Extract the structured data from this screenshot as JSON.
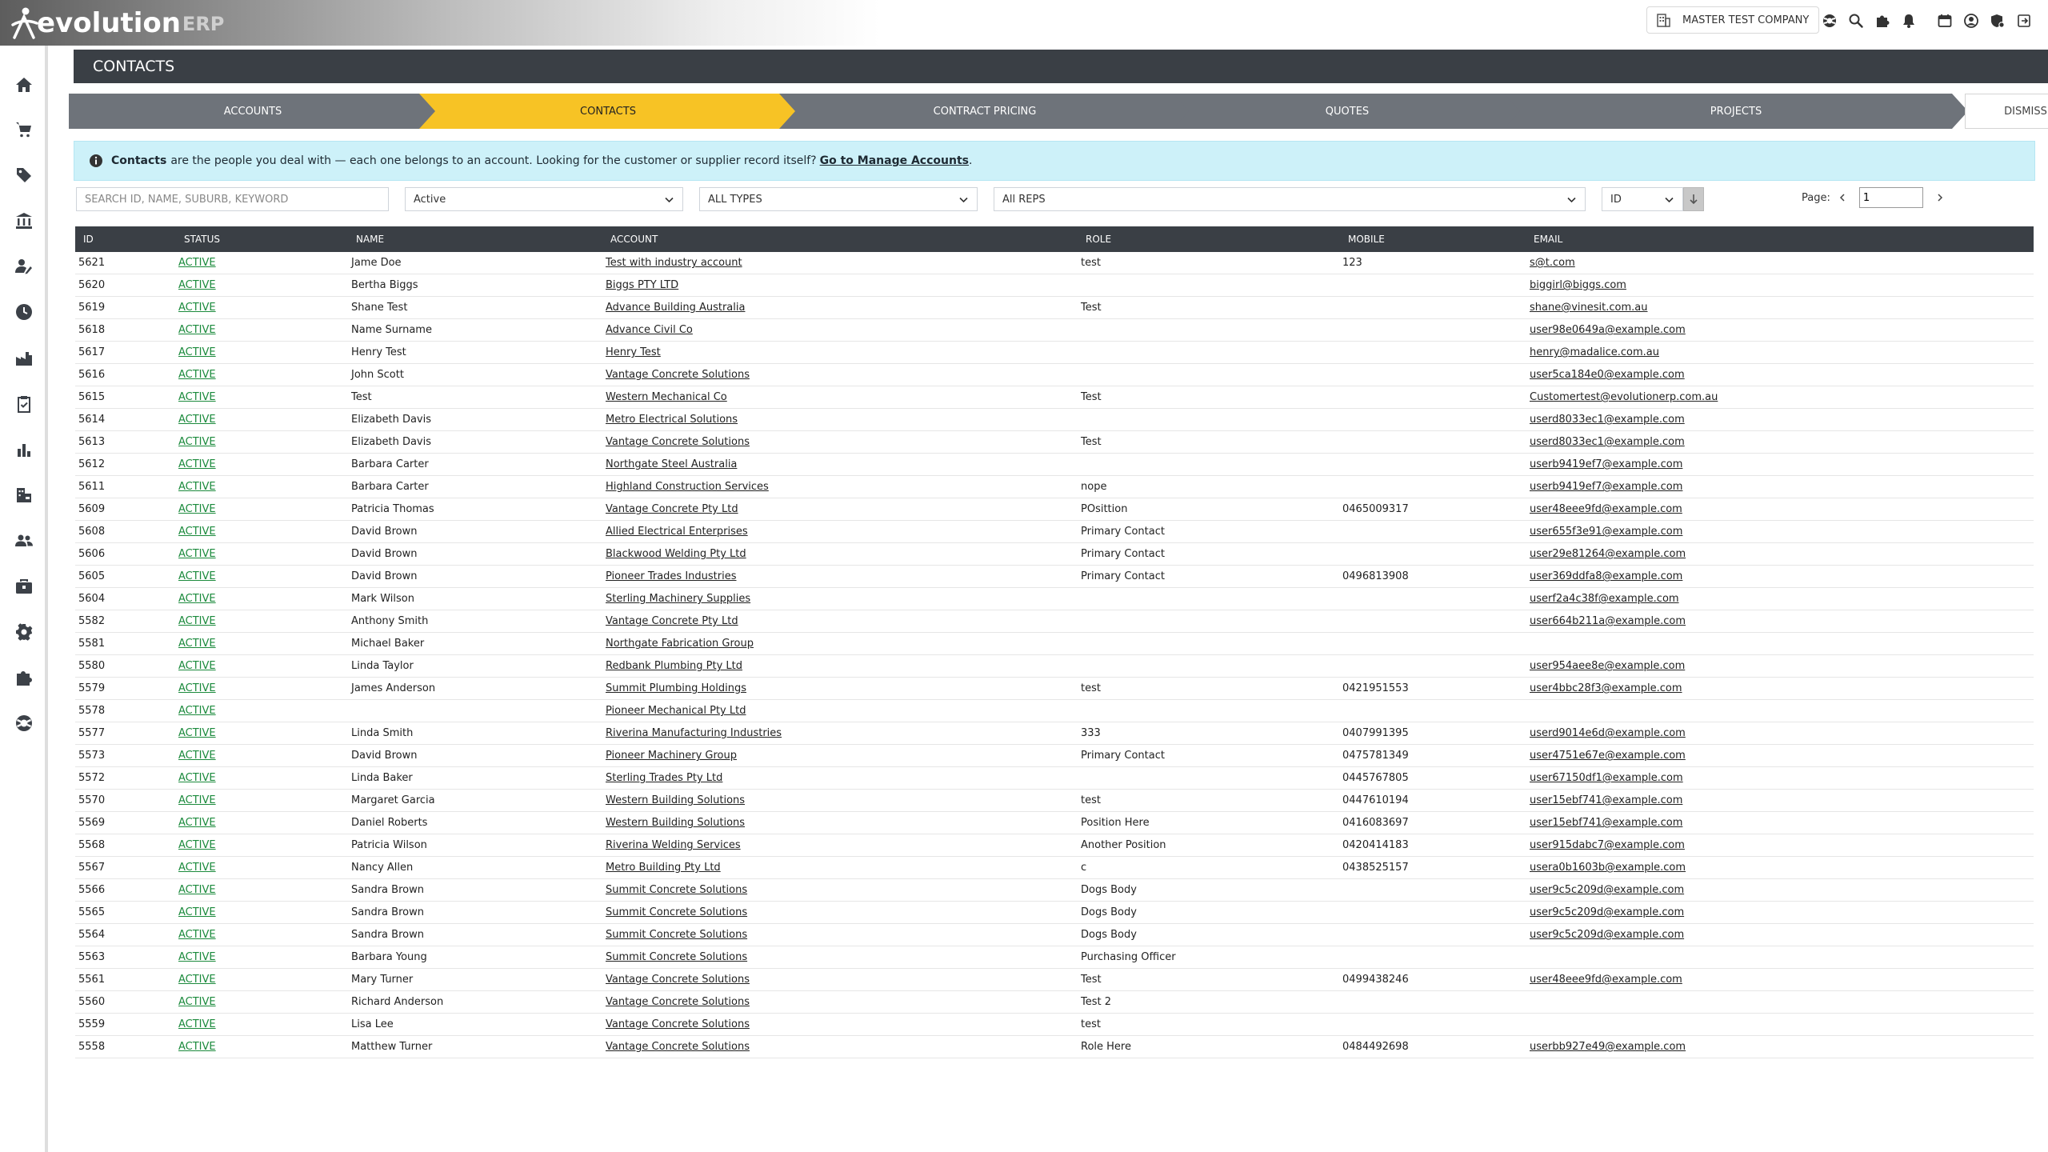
{
  "header": {
    "logo_text": "evolution",
    "logo_suffix": "ERP",
    "company": "MASTER TEST COMPANY"
  },
  "page": {
    "title": "CONTACTS"
  },
  "steps": [
    {
      "label": "ACCOUNTS",
      "active": false
    },
    {
      "label": "CONTACTS",
      "active": true
    },
    {
      "label": "CONTRACT PRICING",
      "active": false
    },
    {
      "label": "QUOTES",
      "active": false
    },
    {
      "label": "PROJECTS",
      "active": false
    }
  ],
  "dismiss_label": "DISMISS",
  "banner": {
    "bold": "Contacts",
    "text": "are the people you deal with — each one belongs to an account. Looking for the customer or supplier record itself?",
    "link": "Go to Manage Accounts",
    "end": "."
  },
  "filters": {
    "search_placeholder": "SEARCH ID, NAME, SUBURB, KEYWORD",
    "status": "Active",
    "type": "ALL TYPES",
    "reps": "All REPS",
    "sort": "ID"
  },
  "pager": {
    "label": "Page:",
    "value": "1"
  },
  "table": {
    "columns": [
      "ID",
      "STATUS",
      "NAME",
      "ACCOUNT",
      "ROLE",
      "MOBILE",
      "EMAIL"
    ],
    "rows": [
      [
        "5621",
        "ACTIVE",
        "Jame Doe",
        "Test with industry account",
        "test",
        "123",
        "s@t.com"
      ],
      [
        "5620",
        "ACTIVE",
        "Bertha Biggs",
        "Biggs PTY LTD",
        "",
        "",
        "biggirl@biggs.com"
      ],
      [
        "5619",
        "ACTIVE",
        "Shane Test",
        "Advance Building Australia",
        "Test",
        "",
        "shane@vinesit.com.au"
      ],
      [
        "5618",
        "ACTIVE",
        "Name Surname",
        "Advance Civil Co",
        "",
        "",
        "user98e0649a@example.com"
      ],
      [
        "5617",
        "ACTIVE",
        "Henry Test",
        "Henry Test",
        "",
        "",
        "henry@madalice.com.au"
      ],
      [
        "5616",
        "ACTIVE",
        "John Scott",
        "Vantage Concrete Solutions",
        "",
        "",
        "user5ca184e0@example.com"
      ],
      [
        "5615",
        "ACTIVE",
        "Test",
        "Western Mechanical Co",
        "Test",
        "",
        "Customertest@evolutionerp.com.au"
      ],
      [
        "5614",
        "ACTIVE",
        "Elizabeth Davis",
        "Metro Electrical Solutions",
        "",
        "",
        "userd8033ec1@example.com"
      ],
      [
        "5613",
        "ACTIVE",
        "Elizabeth Davis",
        "Vantage Concrete Solutions",
        "Test",
        "",
        "userd8033ec1@example.com"
      ],
      [
        "5612",
        "ACTIVE",
        "Barbara Carter",
        "Northgate Steel Australia",
        "",
        "",
        "userb9419ef7@example.com"
      ],
      [
        "5611",
        "ACTIVE",
        "Barbara Carter",
        "Highland Construction Services",
        "nope",
        "",
        "userb9419ef7@example.com"
      ],
      [
        "5609",
        "ACTIVE",
        "Patricia Thomas",
        "Vantage Concrete Pty Ltd",
        "POsittion",
        "0465009317",
        "user48eee9fd@example.com"
      ],
      [
        "5608",
        "ACTIVE",
        "David Brown",
        "Allied Electrical Enterprises",
        "Primary Contact",
        "",
        "user655f3e91@example.com"
      ],
      [
        "5606",
        "ACTIVE",
        "David Brown",
        "Blackwood Welding Pty Ltd",
        "Primary Contact",
        "",
        "user29e81264@example.com"
      ],
      [
        "5605",
        "ACTIVE",
        "David Brown",
        "Pioneer Trades Industries",
        "Primary Contact",
        "0496813908",
        "user369ddfa8@example.com"
      ],
      [
        "5604",
        "ACTIVE",
        "Mark Wilson",
        "Sterling Machinery Supplies",
        "",
        "",
        "userf2a4c38f@example.com"
      ],
      [
        "5582",
        "ACTIVE",
        "Anthony Smith",
        "Vantage Concrete Pty Ltd",
        "",
        "",
        "user664b211a@example.com"
      ],
      [
        "5581",
        "ACTIVE",
        "Michael Baker",
        "Northgate Fabrication Group",
        "",
        "",
        ""
      ],
      [
        "5580",
        "ACTIVE",
        "Linda Taylor",
        "Redbank Plumbing Pty Ltd",
        "",
        "",
        "user954aee8e@example.com"
      ],
      [
        "5579",
        "ACTIVE",
        "James Anderson",
        "Summit Plumbing Holdings",
        "test",
        "0421951553",
        "user4bbc28f3@example.com"
      ],
      [
        "5578",
        "ACTIVE",
        "",
        "Pioneer Mechanical Pty Ltd",
        "",
        "",
        ""
      ],
      [
        "5577",
        "ACTIVE",
        "Linda Smith",
        "Riverina Manufacturing Industries",
        "333",
        "0407991395",
        "userd9014e6d@example.com"
      ],
      [
        "5573",
        "ACTIVE",
        "David Brown",
        "Pioneer Machinery Group",
        "Primary Contact",
        "0475781349",
        "user4751e67e@example.com"
      ],
      [
        "5572",
        "ACTIVE",
        "Linda Baker",
        "Sterling Trades Pty Ltd",
        "",
        "0445767805",
        "user67150df1@example.com"
      ],
      [
        "5570",
        "ACTIVE",
        "Margaret Garcia",
        "Western Building Solutions",
        "test",
        "0447610194",
        "user15ebf741@example.com"
      ],
      [
        "5569",
        "ACTIVE",
        "Daniel Roberts",
        "Western Building Solutions",
        "Position Here",
        "0416083697",
        "user15ebf741@example.com"
      ],
      [
        "5568",
        "ACTIVE",
        "Patricia Wilson",
        "Riverina Welding Services",
        "Another Position",
        "0420414183",
        "user915dabc7@example.com"
      ],
      [
        "5567",
        "ACTIVE",
        "Nancy Allen",
        "Metro Building Pty Ltd",
        "c",
        "0438525157",
        "usera0b1603b@example.com"
      ],
      [
        "5566",
        "ACTIVE",
        "Sandra Brown",
        "Summit Concrete Solutions",
        "Dogs Body",
        "",
        "user9c5c209d@example.com"
      ],
      [
        "5565",
        "ACTIVE",
        "Sandra Brown",
        "Summit Concrete Solutions",
        "Dogs Body",
        "",
        "user9c5c209d@example.com"
      ],
      [
        "5564",
        "ACTIVE",
        "Sandra Brown",
        "Summit Concrete Solutions",
        "Dogs Body",
        "",
        "user9c5c209d@example.com"
      ],
      [
        "5563",
        "ACTIVE",
        "Barbara Young",
        "Summit Concrete Solutions",
        "Purchasing Officer",
        "",
        ""
      ],
      [
        "5561",
        "ACTIVE",
        "Mary Turner",
        "Vantage Concrete Solutions",
        "Test",
        "0499438246",
        "user48eee9fd@example.com"
      ],
      [
        "5560",
        "ACTIVE",
        "Richard Anderson",
        "Vantage Concrete Solutions",
        "Test 2",
        "",
        ""
      ],
      [
        "5559",
        "ACTIVE",
        "Lisa Lee",
        "Vantage Concrete Solutions",
        "test",
        "",
        ""
      ],
      [
        "5558",
        "ACTIVE",
        "Matthew Turner",
        "Vantage Concrete Solutions",
        "Role Here",
        "0484492698",
        "userbb927e49@example.com"
      ]
    ]
  },
  "colors": {
    "dark": "#3a3f45",
    "step_inactive": "#6e737a",
    "step_active": "#f7c325",
    "status_green": "#1b8a3c",
    "banner_bg": "#cdf1f9"
  },
  "sidebar_icons": [
    "home-icon",
    "cart-icon",
    "tag-icon",
    "bank-icon",
    "user-edit-icon",
    "clock-icon",
    "factory-icon",
    "clipboard-check-icon",
    "bar-chart-icon",
    "building-truck-icon",
    "users-icon",
    "toolbox-icon",
    "gear-icon",
    "puzzle-icon",
    "lifebuoy-icon"
  ]
}
